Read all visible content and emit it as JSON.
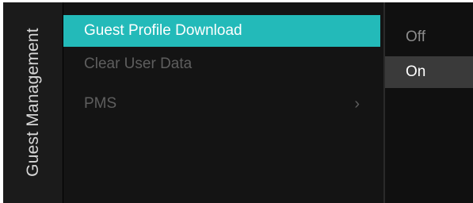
{
  "side": {
    "title": "Guest Management"
  },
  "menu": {
    "items": [
      {
        "label": "Guest Profile Download"
      },
      {
        "label": "Clear User Data"
      },
      {
        "label": "PMS",
        "chevron": "›"
      }
    ]
  },
  "options": {
    "items": [
      {
        "label": "Off"
      },
      {
        "label": "On"
      }
    ],
    "selected_value": "On"
  },
  "colors": {
    "accent": "#23bab9",
    "background": "#000000",
    "focused_option_bg": "#3a3a3a"
  }
}
